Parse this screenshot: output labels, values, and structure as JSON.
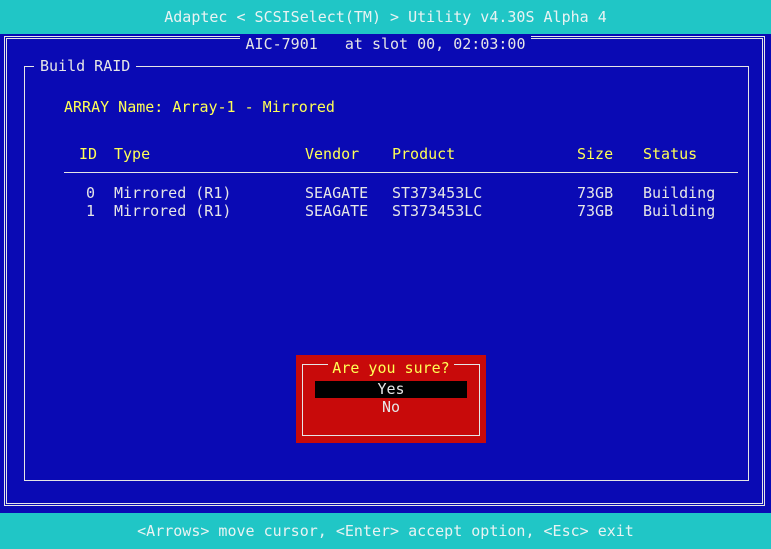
{
  "window": {
    "title": "Adaptec < SCSISelect(TM) > Utility v4.30S Alpha 4",
    "adapter_line": "AIC-7901   at slot 00, 02:03:00"
  },
  "panel": {
    "title": "Build RAID",
    "array_label": "ARRAY Name: Array-1 - Mirrored"
  },
  "table": {
    "columns": [
      "ID",
      "Type",
      "Vendor",
      "Product",
      "Size",
      "Status"
    ],
    "rows": [
      {
        "id": "0",
        "type": "Mirrored (R1)",
        "vendor": "SEAGATE",
        "product": "ST373453LC",
        "size": "73GB",
        "status": "Building"
      },
      {
        "id": "1",
        "type": "Mirrored (R1)",
        "vendor": "SEAGATE",
        "product": "ST373453LC",
        "size": "73GB",
        "status": "Building"
      }
    ]
  },
  "dialog": {
    "title": "Are you sure?",
    "options": [
      "Yes",
      "No"
    ],
    "selected": "Yes"
  },
  "footer": {
    "hint": "<Arrows> move cursor, <Enter> accept option, <Esc> exit"
  },
  "colors": {
    "background": "#0a0ab4",
    "bar": "#20c6c6",
    "highlight": "#ffff55",
    "dialog": "#c80a0a"
  }
}
